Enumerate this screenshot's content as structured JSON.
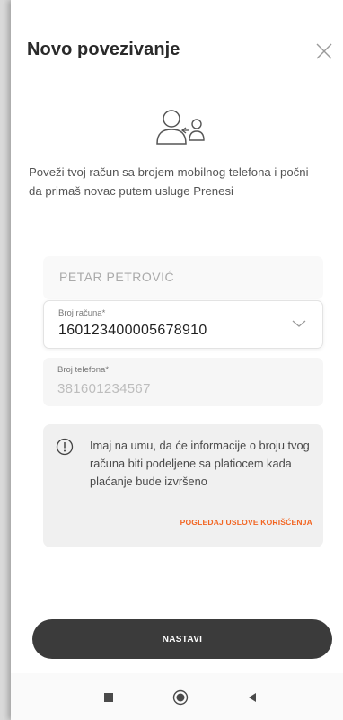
{
  "header": {
    "title": "Novo povezivanje"
  },
  "intro_text": "Poveži tvoj račun sa brojem mobilnog telefona i počni da primaš novac putem usluge Prenesi",
  "form": {
    "name_value": "PETAR PETROVIĆ",
    "account": {
      "label": "Broj računa*",
      "value": "160123400005678910"
    },
    "phone": {
      "label": "Broj telefona*",
      "value": "381601234567"
    }
  },
  "notice": {
    "text": "Imaj na umu, da će informacije o broju tvog računa biti podeljene sa platiocem kada plaćanje bude izvršeno",
    "link_label": "POGLEDAJ USLOVE KORIŠĆENJA",
    "link_color": "#f26522"
  },
  "continue_label": "NASTAVI",
  "icons": {
    "close": "close-icon",
    "illustration": "user-transfer-icon",
    "chevron": "chevron-down-icon",
    "info": "info-icon",
    "nav_recent": "square-icon",
    "nav_home": "circle-icon",
    "nav_back": "triangle-back-icon"
  }
}
